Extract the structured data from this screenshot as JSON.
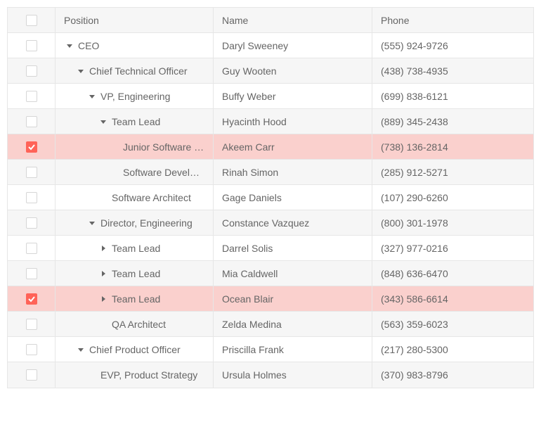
{
  "columns": {
    "position": "Position",
    "name": "Name",
    "phone": "Phone"
  },
  "rows": [
    {
      "position": "CEO",
      "name": "Daryl Sweeney",
      "phone": "(555) 924-9726",
      "indent": 0,
      "expander": "down",
      "alt": false,
      "selected": false
    },
    {
      "position": "Chief Technical Officer",
      "name": "Guy Wooten",
      "phone": "(438) 738-4935",
      "indent": 1,
      "expander": "down",
      "alt": true,
      "selected": false
    },
    {
      "position": "VP, Engineering",
      "name": "Buffy Weber",
      "phone": "(699) 838-6121",
      "indent": 2,
      "expander": "down",
      "alt": false,
      "selected": false
    },
    {
      "position": "Team Lead",
      "name": "Hyacinth Hood",
      "phone": "(889) 345-2438",
      "indent": 3,
      "expander": "down",
      "alt": true,
      "selected": false
    },
    {
      "position": "Junior Software …",
      "name": "Akeem Carr",
      "phone": "(738) 136-2814",
      "indent": 4,
      "expander": "none",
      "alt": false,
      "selected": true
    },
    {
      "position": "Software Develo…",
      "name": "Rinah Simon",
      "phone": "(285) 912-5271",
      "indent": 4,
      "expander": "none",
      "alt": true,
      "selected": false
    },
    {
      "position": "Software Architect",
      "name": "Gage Daniels",
      "phone": "(107) 290-6260",
      "indent": 3,
      "expander": "none",
      "alt": false,
      "selected": false
    },
    {
      "position": "Director, Engineering",
      "name": "Constance Vazquez",
      "phone": "(800) 301-1978",
      "indent": 2,
      "expander": "down",
      "alt": true,
      "selected": false
    },
    {
      "position": "Team Lead",
      "name": "Darrel Solis",
      "phone": "(327) 977-0216",
      "indent": 3,
      "expander": "right",
      "alt": false,
      "selected": false
    },
    {
      "position": "Team Lead",
      "name": "Mia Caldwell",
      "phone": "(848) 636-6470",
      "indent": 3,
      "expander": "right",
      "alt": true,
      "selected": false
    },
    {
      "position": "Team Lead",
      "name": "Ocean Blair",
      "phone": "(343) 586-6614",
      "indent": 3,
      "expander": "right",
      "alt": false,
      "selected": true
    },
    {
      "position": "QA Architect",
      "name": "Zelda Medina",
      "phone": "(563) 359-6023",
      "indent": 3,
      "expander": "none",
      "alt": true,
      "selected": false
    },
    {
      "position": "Chief Product Officer",
      "name": "Priscilla Frank",
      "phone": "(217) 280-5300",
      "indent": 1,
      "expander": "down",
      "alt": false,
      "selected": false
    },
    {
      "position": "EVP, Product Strategy",
      "name": "Ursula Holmes",
      "phone": "(370) 983-8796",
      "indent": 2,
      "expander": "none",
      "alt": true,
      "selected": false
    }
  ]
}
